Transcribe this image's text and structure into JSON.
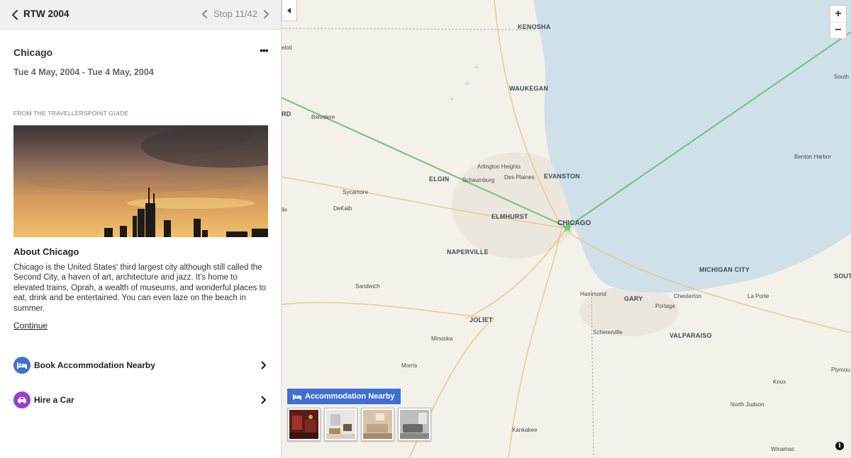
{
  "trip": {
    "title": "RTW 2004",
    "stop_counter": "Stop 11/42"
  },
  "stop": {
    "name": "Chicago",
    "more_label": "•••",
    "dates": "Tue 4 May, 2004 - Tue 4 May, 2004"
  },
  "guide": {
    "source_label": "FROM THE TRAVELLERSPOINT GUIDE",
    "about_title": "About Chicago",
    "about_text": "Chicago is the United States' third largest city although still called the Second City, a haven of art, architecture and jazz. It's home to elevated trains, Oprah, a wealth of museums, and wonderful places to eat, drink and be entertained. You can even laze on the beach in summer.",
    "continue_label": "Continue"
  },
  "actions": [
    {
      "label": "Book Accommodation Nearby",
      "icon": "bed-icon",
      "color": "#3f6fd3"
    },
    {
      "label": "Hire a Car",
      "icon": "car-icon",
      "color": "#9b3fc9"
    }
  ],
  "map": {
    "accommodation_label": "Accommodation Nearby",
    "zoom_in": "+",
    "zoom_out": "−",
    "info": "i",
    "colors": {
      "water": "#cfe0e8",
      "land": "#f4f1ea",
      "route": "#6cc57a",
      "accent": "#3f6fd3"
    },
    "labels": [
      {
        "text": "KENOSHA",
        "cls": "big"
      },
      {
        "text": "WAUKEGAN",
        "cls": "big"
      },
      {
        "text": "EVANSTON",
        "cls": "big"
      },
      {
        "text": "ELGIN",
        "cls": "big"
      },
      {
        "text": "ELMHURST",
        "cls": "big"
      },
      {
        "text": "CHICAGO",
        "cls": "chi"
      },
      {
        "text": "NAPERVILLE",
        "cls": "big"
      },
      {
        "text": "JOLIET",
        "cls": "big"
      },
      {
        "text": "GARY",
        "cls": "big"
      },
      {
        "text": "MICHIGAN CITY",
        "cls": "big"
      },
      {
        "text": "VALPARAISO",
        "cls": "big"
      },
      {
        "text": "SOUT",
        "cls": "big"
      },
      {
        "text": "RD",
        "cls": "big"
      },
      {
        "text": "Arlington Heights",
        "cls": ""
      },
      {
        "text": "Des Plaines",
        "cls": ""
      },
      {
        "text": "Schaumburg",
        "cls": ""
      },
      {
        "text": "Sycamore",
        "cls": ""
      },
      {
        "text": "DeKalb",
        "cls": ""
      },
      {
        "text": "Belvidere",
        "cls": ""
      },
      {
        "text": "Sandwich",
        "cls": ""
      },
      {
        "text": "Minooka",
        "cls": ""
      },
      {
        "text": "Morris",
        "cls": ""
      },
      {
        "text": "Kankakee",
        "cls": ""
      },
      {
        "text": "Hammond",
        "cls": ""
      },
      {
        "text": "Chesterton",
        "cls": ""
      },
      {
        "text": "Portage",
        "cls": ""
      },
      {
        "text": "La Porte",
        "cls": ""
      },
      {
        "text": "Schererville",
        "cls": ""
      },
      {
        "text": "Benton Harbor",
        "cls": ""
      },
      {
        "text": "Knox",
        "cls": ""
      },
      {
        "text": "North Judson",
        "cls": ""
      },
      {
        "text": "Winamac",
        "cls": ""
      },
      {
        "text": "Plymou",
        "cls": ""
      },
      {
        "text": "South",
        "cls": ""
      },
      {
        "text": "eloit",
        "cls": ""
      },
      {
        "text": "lle",
        "cls": ""
      }
    ]
  }
}
